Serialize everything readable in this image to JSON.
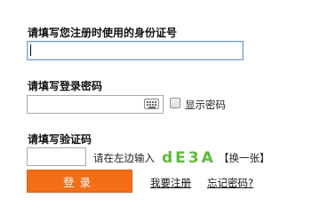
{
  "username": {
    "label": "请填写您注册时使用的身份证号",
    "value": ""
  },
  "password": {
    "label": "请填写登录密码",
    "value": "",
    "keyboard_icon": "keyboard-icon"
  },
  "show_password": {
    "label": "显示密码",
    "checked": false
  },
  "captcha": {
    "label": "请填写验证码",
    "value": "",
    "hint": "请在左边输入",
    "code": "dE3A",
    "refresh_label": "【换一张】"
  },
  "login_button": {
    "label": "登录"
  },
  "links": {
    "register": "我要注册",
    "forgot": "忘记密码?"
  },
  "colors": {
    "button": "#f36f16",
    "captcha_text": "#5fb93a",
    "focus_border": "#7da2ce"
  }
}
